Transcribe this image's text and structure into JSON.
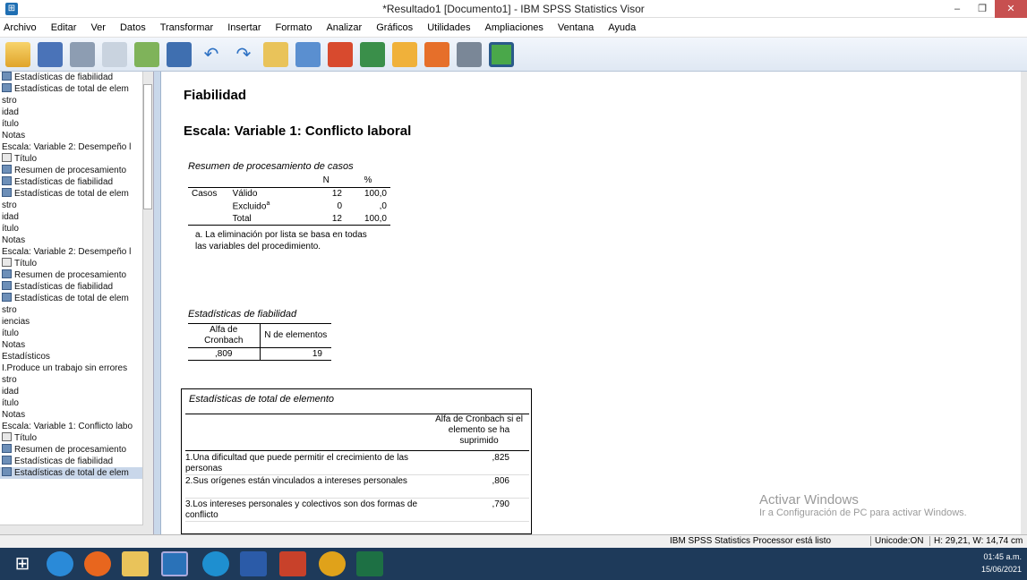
{
  "window": {
    "title": "*Resultado1 [Documento1] - IBM SPSS Statistics Visor",
    "min": "–",
    "max": "❐",
    "close": "✕"
  },
  "menu": [
    "Archivo",
    "Editar",
    "Ver",
    "Datos",
    "Transformar",
    "Insertar",
    "Formato",
    "Analizar",
    "Gráficos",
    "Utilidades",
    "Ampliaciones",
    "Ventana",
    "Ayuda"
  ],
  "nav": [
    {
      "label": "Estadísticas de fiabilidad",
      "icon": "table-icon"
    },
    {
      "label": "Estadísticas de total de elem",
      "icon": "table-icon"
    },
    {
      "label": "stro",
      "icon": ""
    },
    {
      "label": "idad",
      "icon": ""
    },
    {
      "label": "ítulo",
      "icon": ""
    },
    {
      "label": "Notas",
      "icon": ""
    },
    {
      "label": "Escala: Variable 2: Desempeño l",
      "icon": ""
    },
    {
      "label": "Título",
      "icon": "title-icon"
    },
    {
      "label": "Resumen de procesamiento",
      "icon": "table-icon"
    },
    {
      "label": "Estadísticas de fiabilidad",
      "icon": "table-icon"
    },
    {
      "label": "Estadísticas de total de elem",
      "icon": "table-icon"
    },
    {
      "label": "stro",
      "icon": ""
    },
    {
      "label": "idad",
      "icon": ""
    },
    {
      "label": "ítulo",
      "icon": ""
    },
    {
      "label": "Notas",
      "icon": ""
    },
    {
      "label": "Escala: Variable 2: Desempeño l",
      "icon": ""
    },
    {
      "label": "Título",
      "icon": "title-icon"
    },
    {
      "label": "Resumen de procesamiento",
      "icon": "table-icon"
    },
    {
      "label": "Estadísticas de fiabilidad",
      "icon": "table-icon"
    },
    {
      "label": "Estadísticas de total de elem",
      "icon": "table-icon"
    },
    {
      "label": "stro",
      "icon": ""
    },
    {
      "label": "iencias",
      "icon": ""
    },
    {
      "label": "ítulo",
      "icon": ""
    },
    {
      "label": "Notas",
      "icon": ""
    },
    {
      "label": "Estadísticos",
      "icon": ""
    },
    {
      "label": "I.Produce un trabajo sin errores",
      "icon": ""
    },
    {
      "label": "stro",
      "icon": ""
    },
    {
      "label": "idad",
      "icon": ""
    },
    {
      "label": "ítulo",
      "icon": ""
    },
    {
      "label": "Notas",
      "icon": ""
    },
    {
      "label": "Escala: Variable 1: Conflicto labo",
      "icon": ""
    },
    {
      "label": "Título",
      "icon": "title-icon"
    },
    {
      "label": "Resumen de procesamiento",
      "icon": "table-icon"
    },
    {
      "label": "Estadísticas de fiabilidad",
      "icon": "table-icon"
    },
    {
      "label": "Estadísticas de total de elem",
      "icon": "table-icon",
      "selected": true
    }
  ],
  "output": {
    "heading": "Fiabilidad",
    "scale": "Escala: Variable 1: Conflicto laboral",
    "case_summary": {
      "caption": "Resumen de procesamiento de casos",
      "col_n": "N",
      "col_pct": "%",
      "group": "Casos",
      "rows": [
        {
          "label": "Válido",
          "sup": "",
          "n": "12",
          "pct": "100,0"
        },
        {
          "label": "Excluido",
          "sup": "a",
          "n": "0",
          "pct": ",0"
        },
        {
          "label": "Total",
          "sup": "",
          "n": "12",
          "pct": "100,0"
        }
      ],
      "footnote": "a. La eliminación por lista se basa en todas las variables del procedimiento."
    },
    "reliability": {
      "caption": "Estadísticas de fiabilidad",
      "col1": "Alfa de Cronbach",
      "col2": "N de elementos",
      "alpha": ",809",
      "n": "19"
    },
    "item_total": {
      "caption": "Estadísticas de total de elemento",
      "col": "Alfa de Cronbach si el elemento se ha suprimido",
      "rows": [
        {
          "label": "1.Una dificultad que puede permitir el crecimiento de las personas",
          "value": ",825"
        },
        {
          "label": "2.Sus orígenes están vinculados a intereses personales",
          "value": ",806"
        },
        {
          "label": "3.Los intereses personales y colectivos son dos formas de conflicto",
          "value": ",790"
        }
      ]
    }
  },
  "watermark": {
    "line1": "Activar Windows",
    "line2": "Ir a Configuración de PC para activar Windows."
  },
  "status": {
    "processor": "IBM SPSS Statistics Processor está listo",
    "unicode": "Unicode:ON",
    "size": "H: 29,21, W: 14,74 cm"
  },
  "clock": {
    "time": "01:45 a.m.",
    "date": "15/06/2021"
  }
}
